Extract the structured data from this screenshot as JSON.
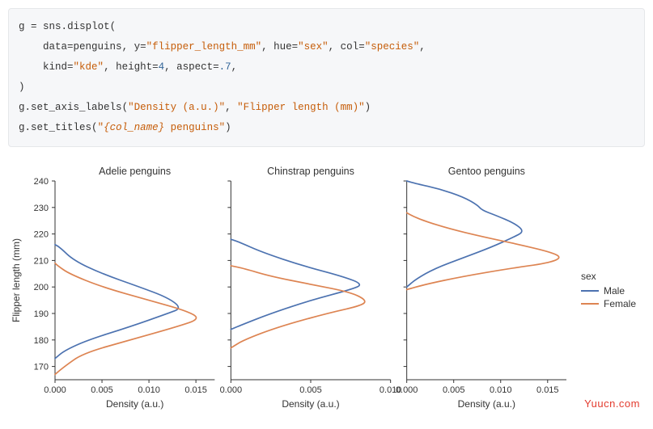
{
  "code": {
    "line1_a": "g ",
    "line1_op": "= ",
    "line1_b": "sns",
    "line1_dot": ".",
    "line1_c": "displot",
    "line1_paren": "(",
    "line2_indent": "    ",
    "line2_a": "data",
    "line2_eq": "=",
    "line2_b": "penguins",
    "line2_c": ", y",
    "line2_eq2": "=",
    "line2_s1": "\"flipper_length_mm\"",
    "line2_d": ", hue",
    "line2_eq3": "=",
    "line2_s2": "\"sex\"",
    "line2_e": ", col",
    "line2_eq4": "=",
    "line2_s3": "\"species\"",
    "line2_f": ",",
    "line3_indent": "    ",
    "line3_a": "kind",
    "line3_eq": "=",
    "line3_s1": "\"kde\"",
    "line3_b": ", height",
    "line3_eq2": "=",
    "line3_n1": "4",
    "line3_c": ", aspect",
    "line3_eq3": "=",
    "line3_n2": ".7",
    "line3_d": ",",
    "line4": ")",
    "line5_a": "g",
    "line5_dot": ".",
    "line5_b": "set_axis_labels",
    "line5_p": "(",
    "line5_s1": "\"Density (a.u.)\"",
    "line5_c": ", ",
    "line5_s2": "\"Flipper length (mm)\"",
    "line5_p2": ")",
    "line6_a": "g",
    "line6_dot": ".",
    "line6_b": "set_titles",
    "line6_p": "(",
    "line6_q": "\"",
    "line6_s1": "{col_name}",
    "line6_s2": " penguins",
    "line6_q2": "\"",
    "line6_p2": ")"
  },
  "chart_data": {
    "type": "kde",
    "ylabel": "Flipper length (mm)",
    "xlabel": "Density (a.u.)",
    "ylim": [
      165,
      240
    ],
    "yticks": [
      170,
      180,
      190,
      200,
      210,
      220,
      230,
      240
    ],
    "legend": {
      "title": "sex",
      "entries": [
        "Male",
        "Female"
      ],
      "colors": [
        "#4c72b0",
        "#dd8452"
      ]
    },
    "panels": [
      {
        "title": "Adelie penguins",
        "xlim": [
          0,
          0.017
        ],
        "xticks": [
          0.0,
          0.005,
          0.01,
          0.015
        ],
        "series": [
          {
            "name": "Male",
            "color": "#4c72b0",
            "points": [
              [
                0,
                173
              ],
              [
                0.001,
                176
              ],
              [
                0.0035,
                180
              ],
              [
                0.008,
                185
              ],
              [
                0.012,
                190
              ],
              [
                0.0135,
                192
              ],
              [
                0.012,
                196
              ],
              [
                0.009,
                200
              ],
              [
                0.005,
                205
              ],
              [
                0.002,
                210
              ],
              [
                0.0005,
                215
              ],
              [
                0,
                216
              ]
            ]
          },
          {
            "name": "Female",
            "color": "#dd8452",
            "points": [
              [
                0,
                167
              ],
              [
                0.001,
                170
              ],
              [
                0.003,
                175
              ],
              [
                0.008,
                180
              ],
              [
                0.013,
                185
              ],
              [
                0.0155,
                188
              ],
              [
                0.014,
                191
              ],
              [
                0.01,
                195
              ],
              [
                0.005,
                200
              ],
              [
                0.0015,
                205
              ],
              [
                0.0003,
                208
              ],
              [
                0,
                209
              ]
            ]
          }
        ]
      },
      {
        "title": "Chinstrap penguins",
        "xlim": [
          0,
          0.01
        ],
        "xticks": [
          0.0,
          0.005,
          0.01
        ],
        "series": [
          {
            "name": "Male",
            "color": "#4c72b0",
            "points": [
              [
                0,
                184
              ],
              [
                0.0008,
                186
              ],
              [
                0.0025,
                190
              ],
              [
                0.005,
                195
              ],
              [
                0.0075,
                199
              ],
              [
                0.0083,
                201
              ],
              [
                0.007,
                204
              ],
              [
                0.0045,
                208
              ],
              [
                0.002,
                213
              ],
              [
                0.0005,
                217
              ],
              [
                0,
                218
              ]
            ]
          },
          {
            "name": "Female",
            "color": "#dd8452",
            "points": [
              [
                0,
                177
              ],
              [
                0.0008,
                180
              ],
              [
                0.003,
                185
              ],
              [
                0.006,
                190
              ],
              [
                0.0082,
                193
              ],
              [
                0.0085,
                195
              ],
              [
                0.0075,
                198
              ],
              [
                0.005,
                201
              ],
              [
                0.0025,
                204
              ],
              [
                0.0008,
                207
              ],
              [
                0,
                208
              ]
            ]
          }
        ]
      },
      {
        "title": "Gentoo penguins",
        "xlim": [
          0,
          0.017
        ],
        "xticks": [
          0.0,
          0.005,
          0.01,
          0.015
        ],
        "series": [
          {
            "name": "Male",
            "color": "#4c72b0",
            "points": [
              [
                0,
                200
              ],
              [
                0.001,
                203
              ],
              [
                0.003,
                207
              ],
              [
                0.006,
                211
              ],
              [
                0.009,
                215
              ],
              [
                0.0115,
                219
              ],
              [
                0.0125,
                221
              ],
              [
                0.0115,
                224
              ],
              [
                0.0095,
                227
              ],
              [
                0.008,
                229
              ],
              [
                0.0075,
                231
              ],
              [
                0.006,
                234
              ],
              [
                0.0035,
                237
              ],
              [
                0.001,
                239
              ],
              [
                0,
                240
              ]
            ]
          },
          {
            "name": "Female",
            "color": "#dd8452",
            "points": [
              [
                0,
                199
              ],
              [
                0.002,
                201
              ],
              [
                0.006,
                204
              ],
              [
                0.011,
                207
              ],
              [
                0.015,
                209
              ],
              [
                0.0165,
                211
              ],
              [
                0.0155,
                213
              ],
              [
                0.012,
                216
              ],
              [
                0.008,
                219
              ],
              [
                0.0045,
                222
              ],
              [
                0.0018,
                225
              ],
              [
                0.0005,
                227
              ],
              [
                0,
                228
              ]
            ]
          }
        ]
      }
    ]
  },
  "watermark": "Yuucn.com"
}
